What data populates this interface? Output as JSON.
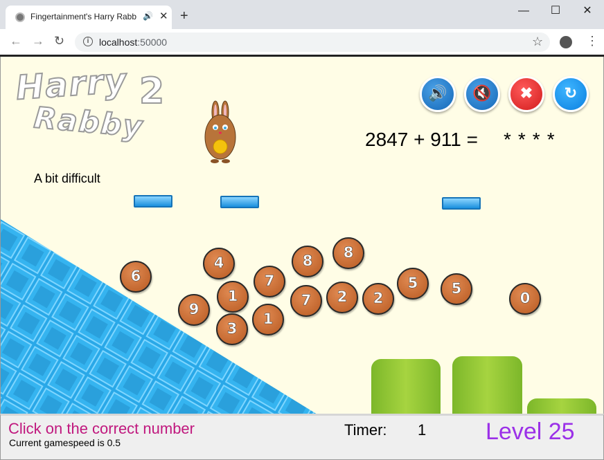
{
  "browser": {
    "tab_title": "Fingertainment's Harry Rabb",
    "tab_audio_icon": "speaker-icon",
    "tab_close": "✕",
    "new_tab": "+",
    "window_min": "—",
    "window_max": "☐",
    "window_close": "✕",
    "url_host": "localhost",
    "url_port": ":50000"
  },
  "game": {
    "logo_line1": "Harry",
    "logo_line2": "Rabby",
    "logo_number": "2",
    "question": "2847 + 911 =",
    "answer_mask": "****",
    "difficulty": "A bit difficult",
    "controls": [
      {
        "name": "sound-on-button",
        "icon": "speaker-loud-icon",
        "glyph": "🔊"
      },
      {
        "name": "mute-button",
        "icon": "speaker-mute-icon",
        "glyph": "🔇"
      },
      {
        "name": "quit-button",
        "icon": "close-icon",
        "glyph": "✖"
      },
      {
        "name": "restart-button",
        "icon": "refresh-icon",
        "glyph": "↻"
      }
    ],
    "coins": [
      "6",
      "4",
      "1",
      "7",
      "8",
      "8",
      "9",
      "3",
      "1",
      "7",
      "2",
      "2",
      "5",
      "5",
      "0"
    ],
    "colors": {
      "background": "#fffde6",
      "slope": "#29a8e8",
      "coin": "#c8692f",
      "bush": "#8dc63f"
    }
  },
  "status": {
    "instruction": "Click on the correct number",
    "gamespeed": "Current gamespeed is 0.5",
    "timer_label": "Timer:",
    "timer_value": "1",
    "level": "Level 25"
  }
}
